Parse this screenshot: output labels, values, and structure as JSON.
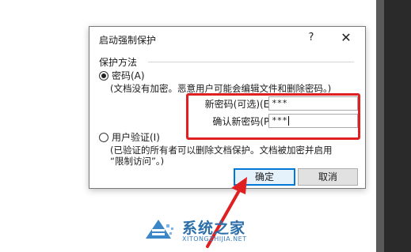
{
  "dialog": {
    "title": "启动强制保护",
    "help_label": "?",
    "close_label": "✕"
  },
  "group": {
    "legend": "保护方法"
  },
  "password_option": {
    "label": "密码(A)",
    "checked": true,
    "note": "(文档没有加密。恶意用户可能会编辑文件和删除密码。)",
    "new_password_label": "新密码(可选)(E):",
    "new_password_value": "***",
    "confirm_password_label": "确认新密码(P):",
    "confirm_password_value": "***"
  },
  "user_auth_option": {
    "label": "用户验证(I)",
    "checked": false,
    "note_line1": "(已验证的所有者可以删除文档保护。文档被加密并启用",
    "note_line2": "“限制访问”。)"
  },
  "buttons": {
    "ok": "确定",
    "cancel": "取消"
  },
  "watermark": {
    "brand": "系统之家",
    "url": "XITONGZHIJIA.NET"
  },
  "colors": {
    "highlight": "#e02020",
    "accent": "#0078d7",
    "brand": "#2b6ea8"
  }
}
